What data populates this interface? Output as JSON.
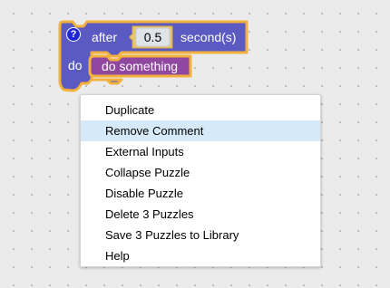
{
  "block": {
    "label_after": "after",
    "number_value": "0.5",
    "label_unit": "second(s)",
    "label_do": "do",
    "inner_block_label": "do something",
    "colors": {
      "outer_fill": "#5a5ac2",
      "selected_outline": "#f2b03c",
      "inner_fill": "#8f47a0",
      "help_icon": "#1e26d6"
    }
  },
  "help_icon": {
    "glyph": "?",
    "icon_name": "help-icon"
  },
  "context_menu": {
    "items": [
      {
        "label": "Duplicate",
        "highlighted": false
      },
      {
        "label": "Remove Comment",
        "highlighted": true
      },
      {
        "label": "External Inputs",
        "highlighted": false
      },
      {
        "label": "Collapse Puzzle",
        "highlighted": false
      },
      {
        "label": "Disable Puzzle",
        "highlighted": false
      },
      {
        "label": "Delete 3 Puzzles",
        "highlighted": false
      },
      {
        "label": "Save 3 Puzzles to Library",
        "highlighted": false
      },
      {
        "label": "Help",
        "highlighted": false
      }
    ]
  }
}
